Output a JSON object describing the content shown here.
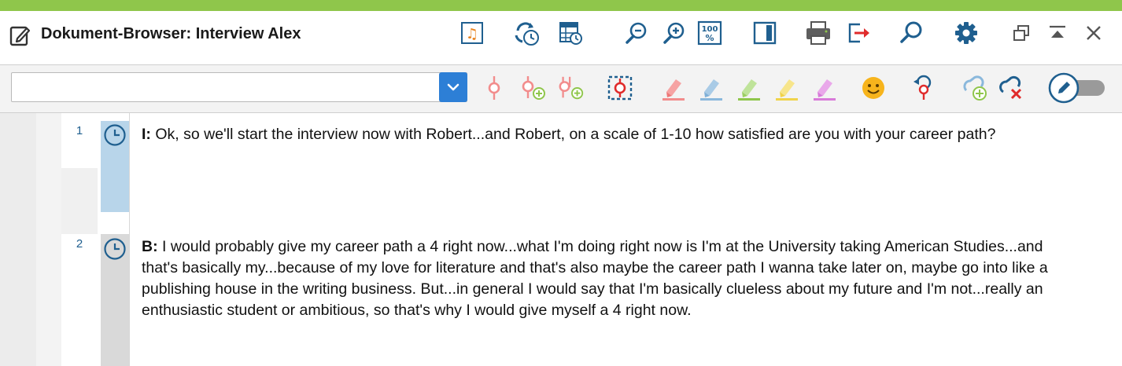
{
  "window": {
    "title": "Dokument-Browser: Interview Alex",
    "accent_color": "#8fc64b"
  },
  "title_toolbar": {
    "icons": [
      "media-file-icon",
      "sync-timestamps-icon",
      "timestamp-table-icon",
      "zoom-out-icon",
      "zoom-in-icon",
      "zoom-100-icon",
      "panel-toggle-icon",
      "print-icon",
      "export-icon",
      "search-icon",
      "settings-gear-icon",
      "restore-window-icon",
      "collapse-icon",
      "close-icon"
    ],
    "zoom_100_label": "100"
  },
  "code_toolbar": {
    "combo": {
      "value": "",
      "placeholder": ""
    },
    "icons": [
      "code-icon",
      "code-new-icon",
      "code-multi-new-icon",
      "code-selection-icon",
      "highlighter-red-icon",
      "highlighter-blue-icon",
      "highlighter-green-icon",
      "highlighter-yellow-icon",
      "highlighter-magenta-icon",
      "emoticon-icon",
      "undo-code-icon",
      "link-add-icon",
      "link-remove-icon",
      "edit-mode-toggle"
    ]
  },
  "paragraphs": [
    {
      "number": "1",
      "speaker": "I:",
      "text": " Ok, so we'll start the interview now with Robert...and Robert, on a scale of 1-10 how satisfied are you with your career path?",
      "bar_color": "#b8d5ea"
    },
    {
      "number": "2",
      "speaker": "B:",
      "text": " I would probably give my career path a 4 right now...what I'm doing right now is I'm at the University taking American Studies...and that's basically my...because of my love for literature and that's also maybe the career path I wanna take later on, maybe go into like a publishing house in the writing business. But...in general I would say that I'm basically clueless about my future and I'm not...really an enthusiastic student or ambitious, so that's why I would give myself a 4 right now.",
      "bar_color": "#d9d9d9"
    }
  ]
}
